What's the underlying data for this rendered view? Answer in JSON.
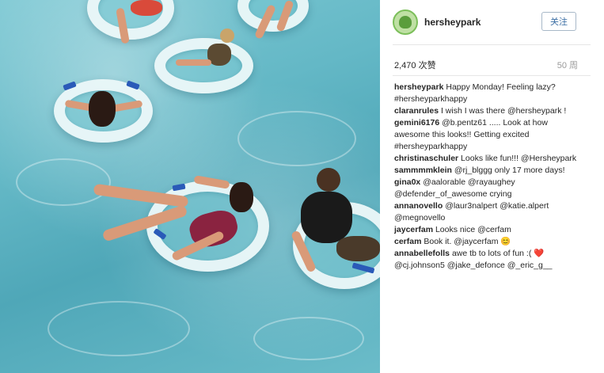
{
  "post": {
    "username": "hersheypark",
    "follow_label": "关注",
    "likes": "2,470 次赞",
    "age": "50 周"
  },
  "comments": [
    {
      "user": "hersheypark",
      "text": "Happy Monday! Feeling lazy? #hersheyparkhappy"
    },
    {
      "user": "claranrules",
      "text": "I wish I was there @hersheypark !"
    },
    {
      "user": "gemini6176",
      "text": "@b.pentz61 ..... Look at how awesome this looks!! Getting excited #hersheyparkhappy"
    },
    {
      "user": "christinaschuler",
      "text": "Looks like fun!!! @Hersheypark"
    },
    {
      "user": "sammmmklein",
      "text": "@rj_blggg only 17 more days!"
    },
    {
      "user": "gina0x",
      "text": "@aalorable @rayaughey @defender_of_awesome crying"
    },
    {
      "user": "annanovello",
      "text": "@laur3nalpert @katie.alpert @megnovello"
    },
    {
      "user": "jaycerfam",
      "text": "Looks nice @cerfam"
    },
    {
      "user": "cerfam",
      "text": "Book it. @jaycerfam 😊"
    },
    {
      "user": "annabellefolls",
      "text": "awe tb to lots of fun :( ❤️ @cj.johnson5 @jake_defonce @_eric_g__"
    }
  ],
  "icons": {
    "avatar": "hersheypark-logo-icon"
  },
  "colors": {
    "water": "#64b8c6",
    "tube": "#f0f8fa",
    "handle": "#2a5ab8",
    "follow_text": "#3d6fa5"
  }
}
